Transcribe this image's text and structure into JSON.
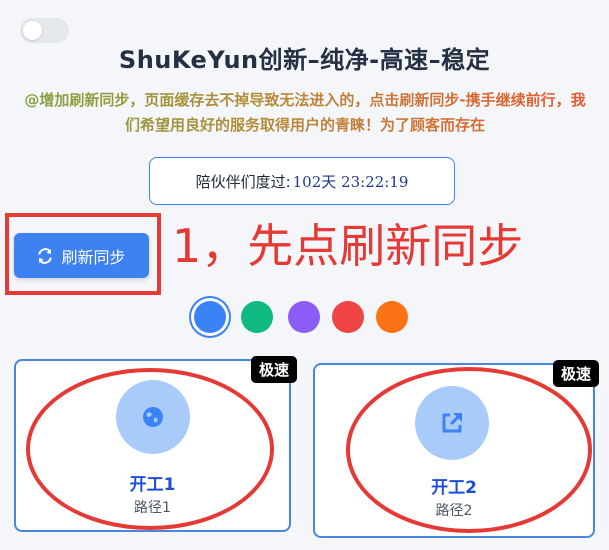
{
  "header": {
    "title": "ShuKeYun创新–纯净-高速–稳定",
    "notice": "@增加刷新同步，页面缓存去不掉导致无法进入的，点击刷新同步-携手继续前行，我们希望用良好的服务取得用户的青睐！为了顾客而存在"
  },
  "uptime": {
    "label": "陪伙伴们度过:",
    "value": "102天 23:22:19"
  },
  "refresh": {
    "label": "刷新同步",
    "icon": "refresh-icon"
  },
  "annotation": {
    "text": "1，先点刷新同步",
    "color": "#e53935"
  },
  "theme_colors": [
    {
      "color": "#3b82f6",
      "selected": true
    },
    {
      "color": "#10b981",
      "selected": false
    },
    {
      "color": "#8b5cf6",
      "selected": false
    },
    {
      "color": "#ef4444",
      "selected": false
    },
    {
      "color": "#f97316",
      "selected": false
    }
  ],
  "cards": [
    {
      "badge": "极速",
      "title": "开工1",
      "subtitle": "路径1",
      "icon": "globe-icon"
    },
    {
      "badge": "极速",
      "title": "开工2",
      "subtitle": "路径2",
      "icon": "external-link-icon"
    }
  ]
}
